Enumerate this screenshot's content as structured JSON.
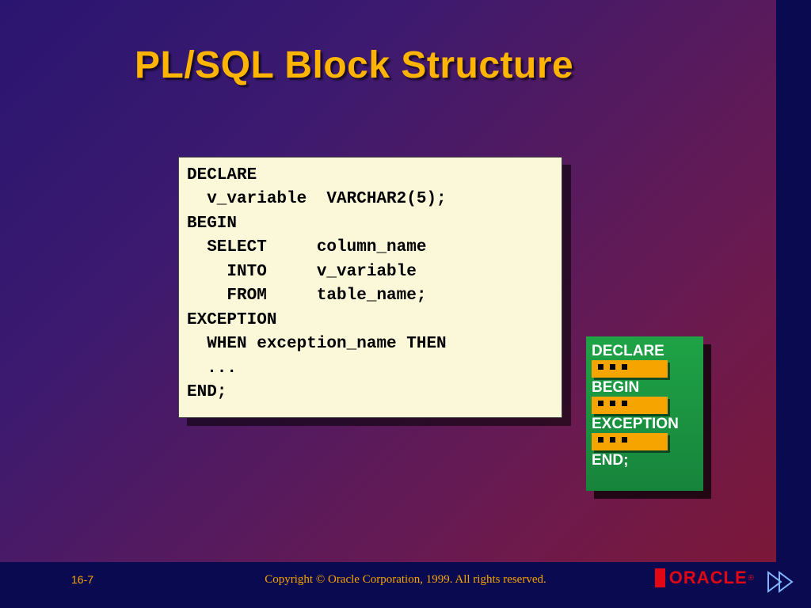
{
  "title": "PL/SQL Block Structure",
  "code": {
    "l1": "DECLARE",
    "l2": "  v_variable  VARCHAR2(5);",
    "l3": "BEGIN",
    "l4": "  SELECT     column_name",
    "l5": "    INTO     v_variable",
    "l6": "    FROM     table_name;",
    "l7": "EXCEPTION",
    "l8": "  WHEN exception_name THEN",
    "l9": "  ...",
    "l10": "END;"
  },
  "mini": {
    "declare": "DECLARE",
    "begin": "BEGIN",
    "exception": "EXCEPTION",
    "end": "END;"
  },
  "footer": {
    "page": "16-7",
    "copyright": "Copyright © Oracle Corporation, 1999. All rights reserved.",
    "logo_text": "ORACLE",
    "logo_reg": "®"
  }
}
